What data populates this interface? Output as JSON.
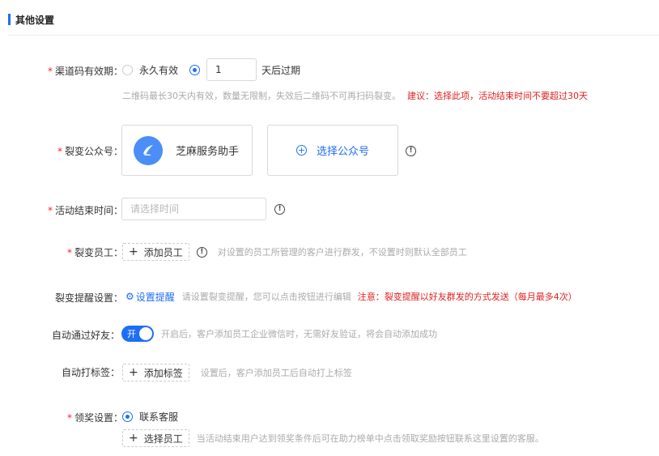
{
  "section": {
    "title": "其他设置"
  },
  "qr_validity": {
    "label": "渠道码有效期：",
    "option_forever": "永久有效",
    "days_value": "1",
    "days_suffix": "天后过期",
    "hint": "二维码最长30天内有效，数量无限制，失效后二维码不可再扫码裂变。",
    "warning": "建议：选择此项，活动结束时间不要超过30天"
  },
  "official_account": {
    "label": "裂变公众号：",
    "account_name": "芝麻服务助手",
    "select_label": "选择公众号"
  },
  "end_time": {
    "label": "活动结束时间：",
    "placeholder": "请选择时间"
  },
  "staff": {
    "label": "裂变员工：",
    "add_label": "添加员工",
    "hint": "对设置的员工所管理的客户进行群发，不设置时则默认全部员工"
  },
  "reminder": {
    "label": "裂变提醒设置：",
    "link_label": "设置提醒",
    "hint": "请设置裂变提醒，您可以点击按钮进行编辑",
    "warning": "注意：裂变提醒以好友群发的方式发送（每月最多4次）"
  },
  "auto_accept": {
    "label": "自动通过好友：",
    "switch_text": "开",
    "hint": "开启后，客户添加员工企业微信时，无需好友验证，将会自动添加成功"
  },
  "auto_tag": {
    "label": "自动打标签：",
    "add_label": "添加标签",
    "hint": "设置后，客户添加员工后自动打上标签"
  },
  "reward": {
    "label": "领奖设置：",
    "option_contact": "联系客服",
    "select_staff_label": "选择员工",
    "hint": "当活动结束用户达到领奖条件后可在助力榜单中点击领取奖励按钮联系这里设置的客服。"
  },
  "colors": {
    "primary": "#1e6ef5",
    "warning": "#e02020",
    "hint": "#aaaaaa"
  }
}
